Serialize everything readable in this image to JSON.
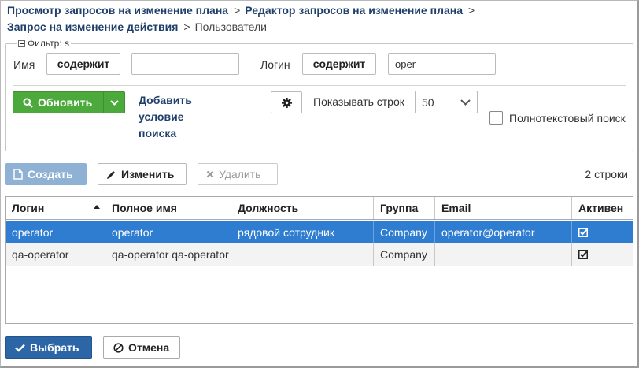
{
  "breadcrumb": {
    "items": [
      "Просмотр запросов на изменение плана",
      "Редактор запросов на изменение плана",
      "Запрос на изменение действия"
    ],
    "current": "Пользователи",
    "separator": ">"
  },
  "filter": {
    "legend": "Фильтр: s",
    "name_label": "Имя",
    "name_operator": "содержит",
    "name_value": "",
    "login_label": "Логин",
    "login_operator": "содержит",
    "login_value": "oper",
    "refresh_label": "Обновить",
    "add_condition_label": "Добавить условие поиска",
    "show_rows_label": "Показывать строк",
    "show_rows_value": "50",
    "fulltext_label": "Полнотекстовый поиск",
    "fulltext_checked": false
  },
  "toolbar": {
    "create_label": "Создать",
    "edit_label": "Изменить",
    "delete_label": "Удалить",
    "rows_count": "2 строки"
  },
  "table": {
    "columns": [
      "Логин",
      "Полное имя",
      "Должность",
      "Группа",
      "Email",
      "Активен"
    ],
    "rows": [
      {
        "login": "operator",
        "full_name": "operator",
        "position": "рядовой сотрудник",
        "group": "Company",
        "email": "operator@operator",
        "active": true
      },
      {
        "login": "qa-operator",
        "full_name": "qa-operator qa-operator",
        "position": "",
        "group": "Company",
        "email": "",
        "active": true
      }
    ]
  },
  "footer": {
    "select_label": "Выбрать",
    "cancel_label": "Отмена"
  },
  "colors": {
    "link": "#1f3f6b",
    "refresh_green": "#4caa3c",
    "selected_row": "#2f7dd0",
    "primary_button": "#2d66a6",
    "create_disabled": "#8fb2d4"
  }
}
